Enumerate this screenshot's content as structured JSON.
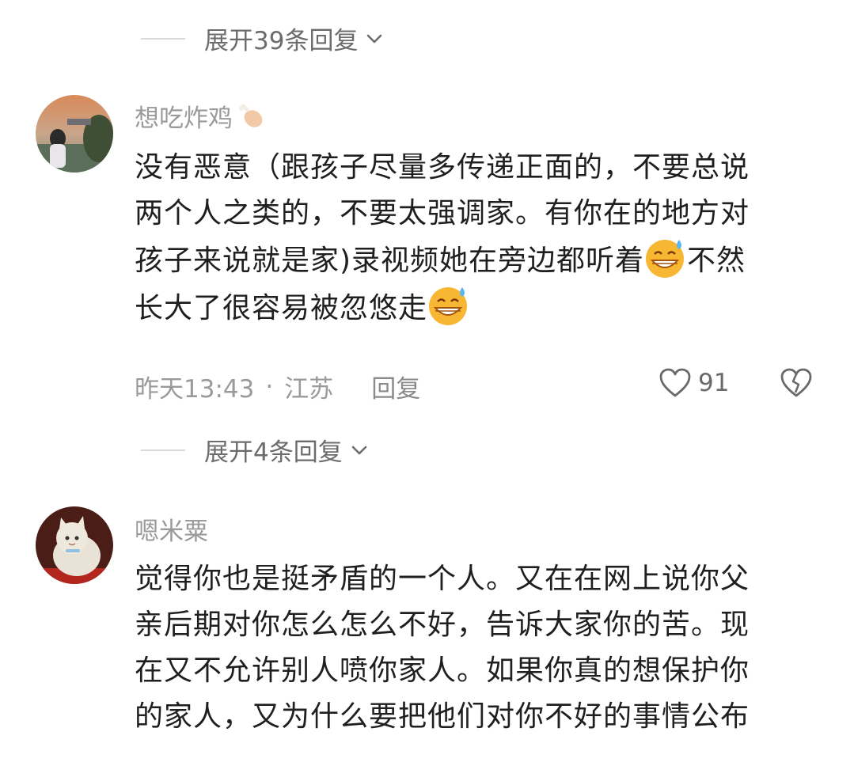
{
  "expand_top": {
    "label": "展开39条回复"
  },
  "comments": [
    {
      "username": "想吃炸鸡",
      "text_lines": [
        "没有恶意（跟孩子尽量多传递正面的，不要总说",
        "两个人之类的，不要太强调家。有你在的地方对",
        "孩子来说就是家)录视频她在旁边都听着",
        "不然",
        "长大了很容易被忽悠走"
      ],
      "time": "昨天13:43",
      "separator": "·",
      "location": "江苏",
      "reply_label": "回复",
      "likes": "91",
      "expand_label": "展开4条回复"
    },
    {
      "username": "嗯米粟",
      "text_lines": [
        "觉得你也是挺矛盾的一个人。又在在网上说你父",
        "亲后期对你怎么怎么不好，告诉大家你的苦。现",
        "在又不允许别人喷你家人。如果你真的想保护你",
        "的家人，又为什么要把他们对你不好的事情公布"
      ]
    }
  ],
  "colors": {
    "text": "#1f1f1f",
    "meta": "#9a9a9a",
    "divider": "#d9d9d9"
  },
  "icons": [
    "chevron-down-icon",
    "drumstick-icon",
    "grinning-sweat-emoji",
    "heart-icon",
    "broken-heart-icon"
  ]
}
